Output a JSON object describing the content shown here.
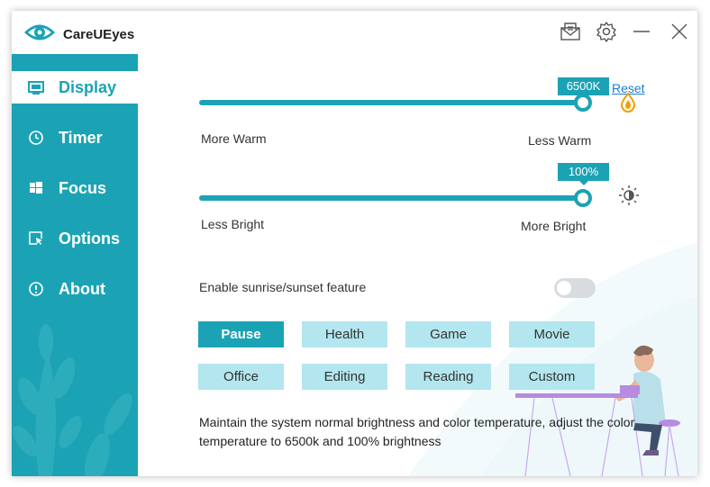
{
  "app": {
    "title": "CareUEyes"
  },
  "titlebar": {
    "icons": [
      "mail-icon",
      "gear-icon",
      "minimize-icon",
      "close-icon"
    ]
  },
  "sidebar": {
    "items": [
      {
        "label": "Display",
        "icon": "monitor-icon",
        "active": true
      },
      {
        "label": "Timer",
        "icon": "clock-icon",
        "active": false
      },
      {
        "label": "Focus",
        "icon": "windows-icon",
        "active": false
      },
      {
        "label": "Options",
        "icon": "cursor-window-icon",
        "active": false
      },
      {
        "label": "About",
        "icon": "info-icon",
        "active": false
      }
    ]
  },
  "display": {
    "temperature": {
      "value_label": "6500K",
      "value_fraction": 1.0,
      "left_label": "More Warm",
      "right_label": "Less Warm",
      "reset_label": "Reset",
      "icon": "drop-icon"
    },
    "brightness": {
      "value_label": "100%",
      "value_fraction": 1.0,
      "left_label": "Less Bright",
      "right_label": "More Bright",
      "icon": "sun-icon"
    },
    "sunrise": {
      "label": "Enable sunrise/sunset feature",
      "enabled": false
    },
    "presets": [
      {
        "label": "Pause",
        "active": true
      },
      {
        "label": "Health",
        "active": false
      },
      {
        "label": "Game",
        "active": false
      },
      {
        "label": "Movie",
        "active": false
      },
      {
        "label": "Office",
        "active": false
      },
      {
        "label": "Editing",
        "active": false
      },
      {
        "label": "Reading",
        "active": false
      },
      {
        "label": "Custom",
        "active": false
      }
    ],
    "description": "Maintain the system normal brightness and color temperature, adjust the color temperature to 6500k and 100% brightness"
  },
  "colors": {
    "accent": "#1ba3b5",
    "preset_bg": "#b3e6ee",
    "link": "#1a7fd1",
    "drop": "#f0a000"
  }
}
